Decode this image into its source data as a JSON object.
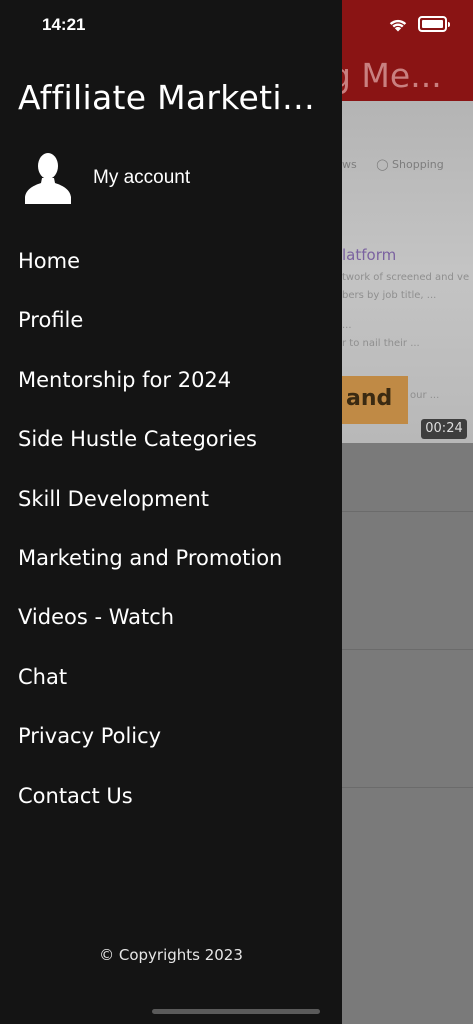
{
  "status_bar": {
    "time": "14:21"
  },
  "background": {
    "header_title_fragment": "g Me...",
    "tabs": [
      "ws",
      "Shopping"
    ],
    "partial_title": "latform",
    "partial_lines": [
      "twork of screened and ve",
      "bers by job title, ...",
      "...",
      "r to nail their ...",
      "our ..."
    ],
    "overlay_word": "and",
    "video_duration": "00:24"
  },
  "drawer": {
    "title": "Affiliate Marketing Me...",
    "account_label": "My account",
    "menu_items": [
      "Home",
      "Profile",
      "Mentorship for 2024",
      "Side Hustle Categories",
      "Skill Development",
      "Marketing and Promotion",
      "Videos - Watch",
      "Chat",
      "Privacy Policy",
      "Contact Us"
    ],
    "copyright": "© Copyrights 2023"
  },
  "colors": {
    "drawer_bg": "#141414",
    "header_bg": "#8a1414",
    "text": "#ffffff"
  },
  "icons": {
    "account": "person-silhouette-icon",
    "wifi": "wifi-icon",
    "battery": "battery-icon"
  }
}
